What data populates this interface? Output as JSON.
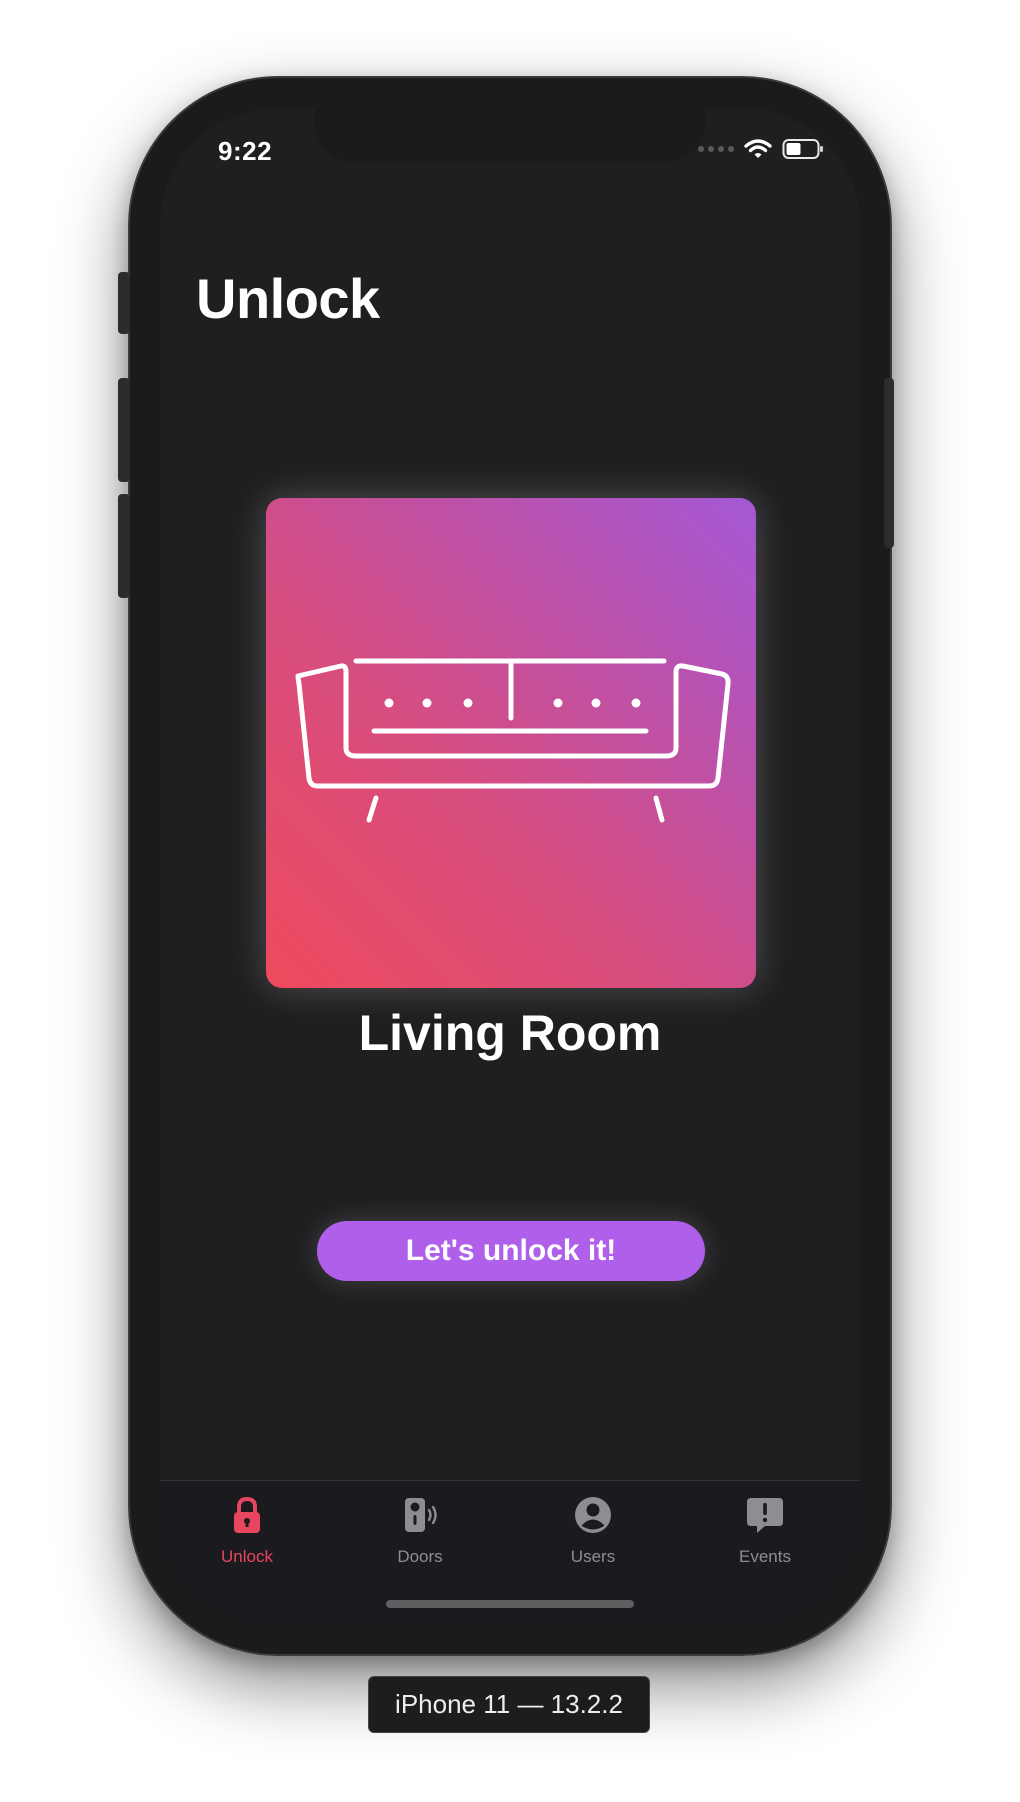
{
  "status_bar": {
    "time": "9:22",
    "icons": [
      "cellular-dots-icon",
      "wifi-icon",
      "battery-icon"
    ]
  },
  "header": {
    "title": "Unlock"
  },
  "room": {
    "name": "Living Room",
    "icon": "sofa-icon",
    "gradient": [
      "#ee4a5c",
      "#a458d6"
    ]
  },
  "action": {
    "unlock_label": "Let's unlock it!",
    "color": "#af5fe9"
  },
  "tab_bar": {
    "accent": "#e84560",
    "items": [
      {
        "label": "Unlock",
        "icon": "lock-icon"
      },
      {
        "label": "Doors",
        "icon": "door-sensor-icon"
      },
      {
        "label": "Users",
        "icon": "user-circle-icon"
      },
      {
        "label": "Events",
        "icon": "alert-bubble-icon"
      }
    ]
  },
  "simulator": {
    "device_label": "iPhone 11 — 13.2.2"
  }
}
